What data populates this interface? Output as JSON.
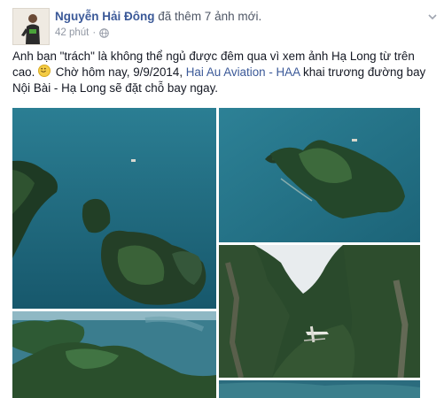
{
  "post": {
    "author_name": "Nguyễn Hải Đông",
    "action_text": "đã thêm 7 ảnh mới.",
    "time_text": "42 phút",
    "separator": "·",
    "privacy_icon": "globe-icon",
    "menu_icon": "chevron-down-icon",
    "text_part1": "Anh bạn \"trách\" là không thể ngủ được đêm qua vì xem ảnh Hạ Long từ trên cao.",
    "emoji": "smile-emoji",
    "text_part2": " Chờ hôm nay, 9/9/2014, ",
    "link_text": "Hai Au Aviation - HAA",
    "text_part3": " khai trương đường bay Nội Bài - Hạ Long sẽ đặt chỗ bay ngay."
  },
  "colors": {
    "name_link": "#3b5998",
    "meta_gray": "#9197a3",
    "body_text": "#141823",
    "bay_water": "#1f6f85"
  }
}
